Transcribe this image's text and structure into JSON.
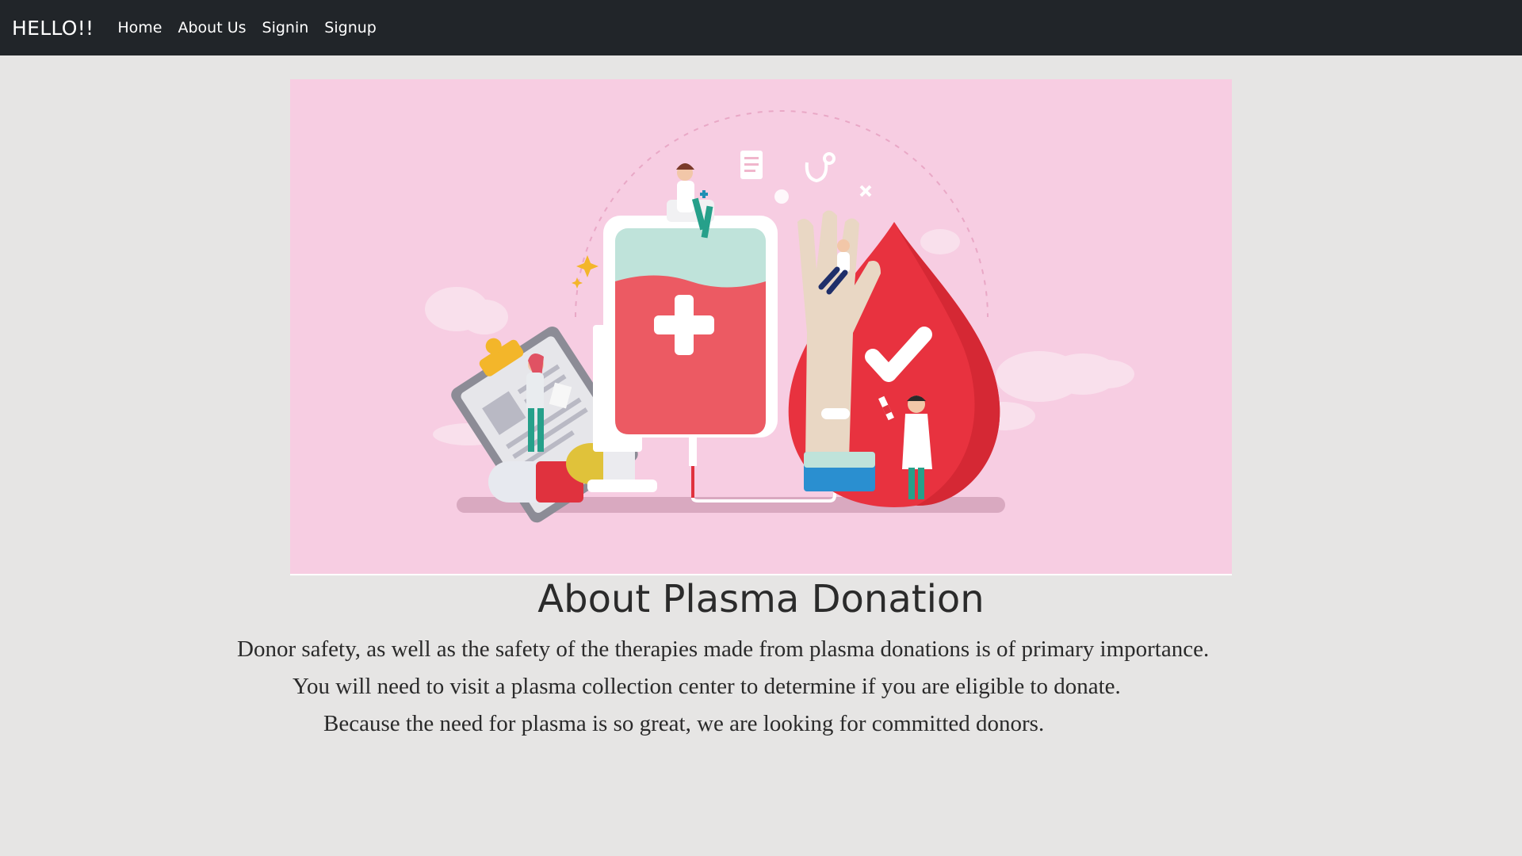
{
  "nav": {
    "brand": "HELLO!!",
    "links": [
      "Home",
      "About Us",
      "Signin",
      "Signup"
    ]
  },
  "hero": {
    "background": "#f7cde2",
    "illustration": "plasma-donation-illustration"
  },
  "content": {
    "title": "About Plasma Donation",
    "paragraphs": [
      "Donor safety, as well as the safety of the therapies made from plasma donations is of primary importance.",
      "You will need to visit a plasma collection center to determine if you are eligible to donate.",
      "Because the need for plasma is so great, we are looking for committed donors."
    ]
  },
  "colors": {
    "navbar": "#212529",
    "page_background": "#e6e5e4",
    "blood_red": "#e8323f",
    "teal": "#26a08a"
  }
}
